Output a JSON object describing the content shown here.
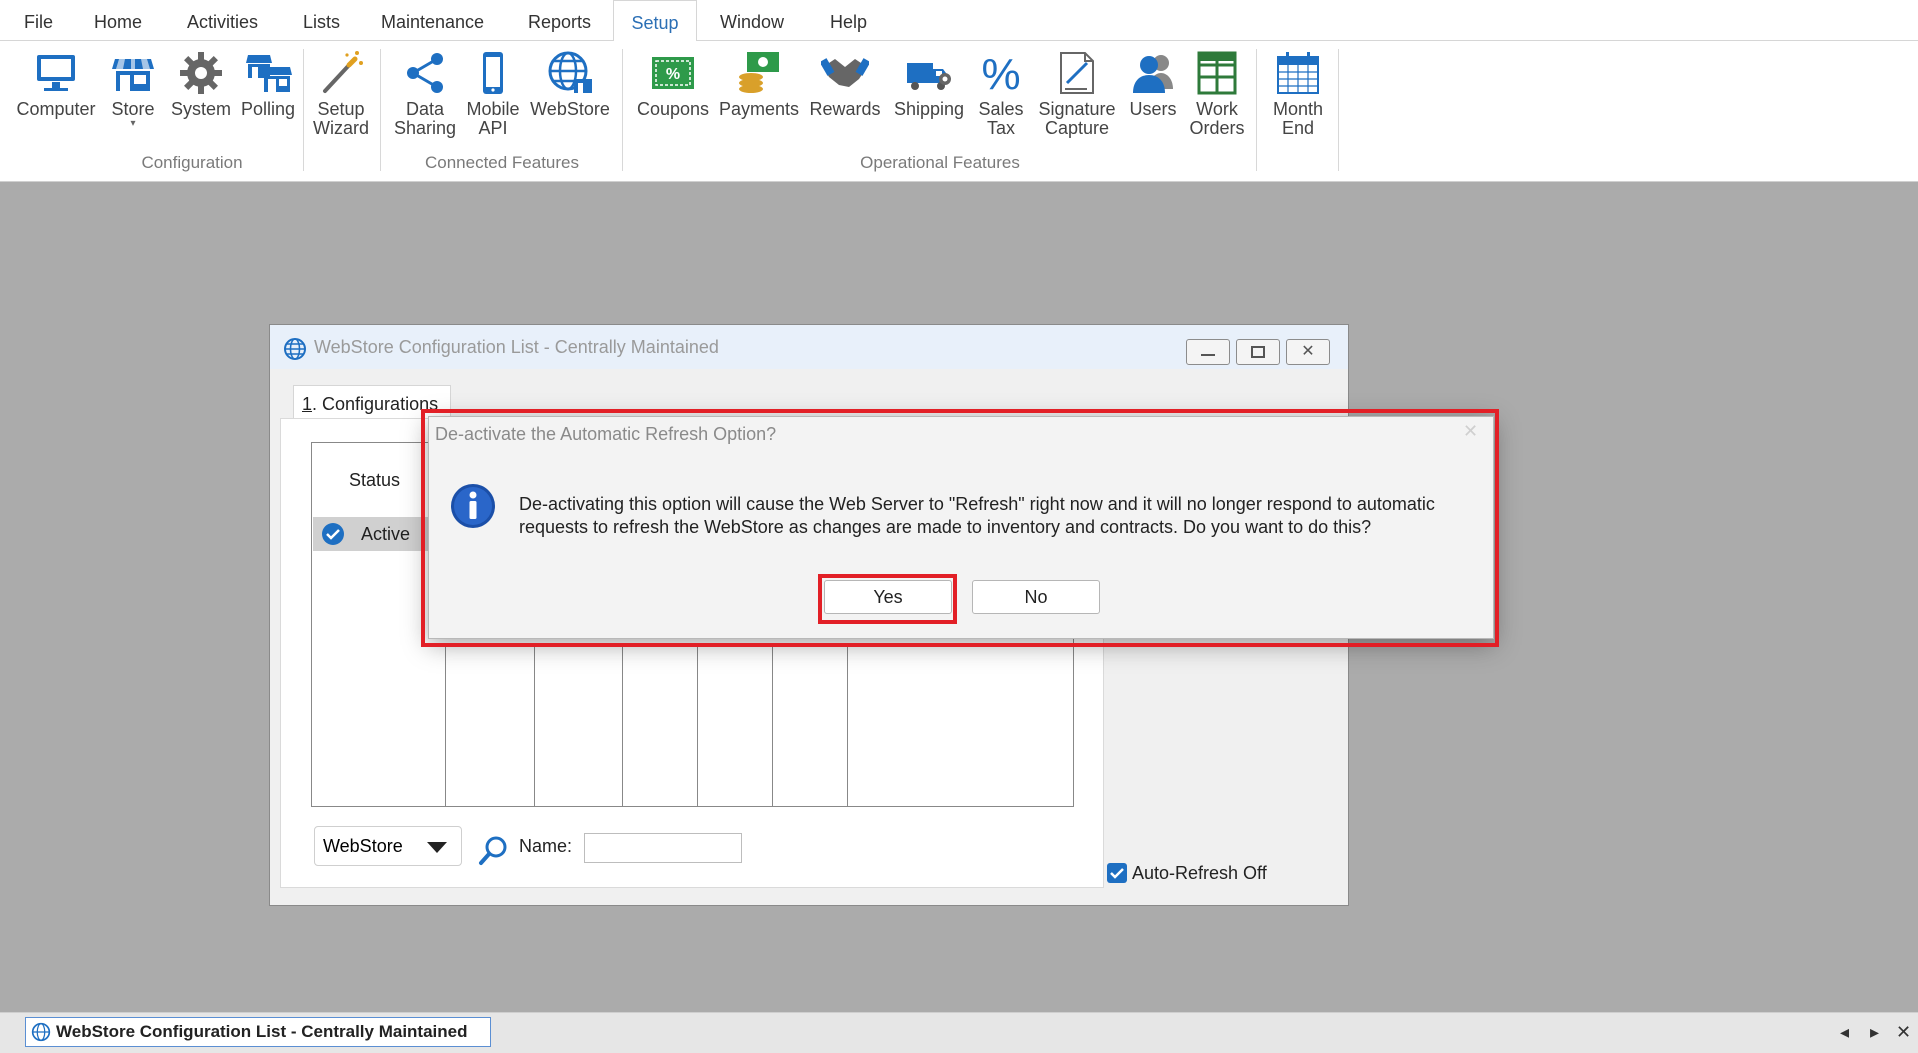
{
  "menu": {
    "items": [
      "File",
      "Home",
      "Activities",
      "Lists",
      "Maintenance",
      "Reports",
      "Setup",
      "Window",
      "Help"
    ],
    "active": "Setup"
  },
  "ribbon": {
    "configuration": {
      "label": "Configuration",
      "buttons": [
        "Computer",
        "Store",
        "System",
        "Polling"
      ]
    },
    "setup_wizard": [
      "Setup",
      "Wizard"
    ],
    "connected": {
      "label": "Connected Features",
      "buttons": [
        [
          "Data",
          "Sharing"
        ],
        [
          "Mobile",
          "API"
        ],
        [
          "WebStore",
          ""
        ]
      ]
    },
    "operational": {
      "label": "Operational Features",
      "buttons": [
        [
          "Coupons",
          ""
        ],
        [
          "Payments",
          ""
        ],
        [
          "Rewards",
          ""
        ],
        [
          "Shipping",
          ""
        ],
        [
          "Sales",
          "Tax"
        ],
        [
          "Signature",
          "Capture"
        ],
        [
          "Users",
          ""
        ],
        [
          "Work",
          "Orders"
        ]
      ]
    },
    "month_end": [
      "Month",
      "End"
    ]
  },
  "child_window": {
    "title": "WebStore Configuration List - Centrally Maintained",
    "tab_hotkey": "1",
    "tab_label": ". Configurations",
    "column_header": "Status",
    "row_status": "Active",
    "search_type": "WebStore",
    "name_label": "Name:",
    "name_value": "",
    "auto_refresh_label": "Auto-Refresh Off",
    "auto_refresh_checked": true
  },
  "dialog": {
    "title": "De-activate the Automatic Refresh Option?",
    "message_line1": "De-activating this option will cause the Web Server to \"Refresh\" right now and it will no longer respond to automatic",
    "message_line2": "requests to refresh the WebStore as changes are made to inventory and contracts.  Do you want to do this?",
    "yes_label": "Yes",
    "no_label": "No"
  },
  "statusbar": {
    "task_title": "WebStore Configuration List - Centrally Maintained"
  },
  "colors": {
    "accent_blue": "#2b6fb5",
    "highlight_red": "#e21f26",
    "workspace_gray": "#ababab"
  }
}
